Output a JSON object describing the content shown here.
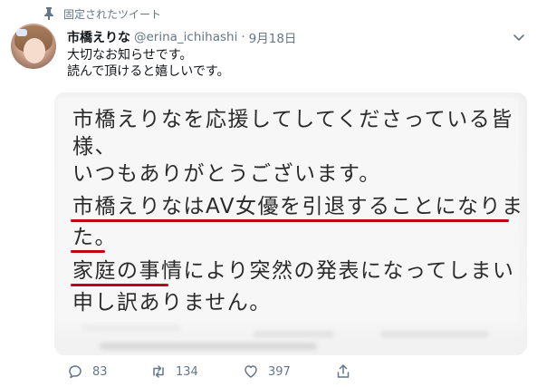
{
  "pinned": {
    "label": "固定されたツイート",
    "icon": "pin-icon"
  },
  "tweet": {
    "name": "市橋えりな",
    "handle": "@erina_ichihashi",
    "separator": "·",
    "date": "9月18日",
    "text_lines": [
      "大切なお知らせです。",
      "読んで頂けると嬉しいです。"
    ]
  },
  "image_text": [
    "市橋えりなを応援してしてくださっている皆",
    "様、",
    "いつもありがとうございます。",
    "市橋えりなはAV女優を引退することになりまし",
    "た。",
    "家庭の事情により突然の発表になってしまい",
    "申し訳ありません。"
  ],
  "actions": {
    "reply_count": "83",
    "retweet_count": "134",
    "like_count": "397"
  },
  "colors": {
    "accent_underline": "#c3001a",
    "secondary_text": "#657786"
  }
}
